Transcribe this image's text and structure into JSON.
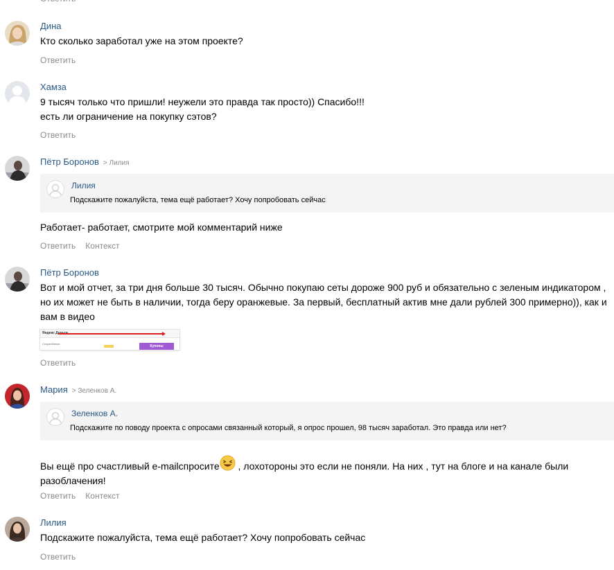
{
  "actions": {
    "reply": "Ответить",
    "context": "Контекст"
  },
  "comments": [
    {
      "author": "Дина",
      "lines": [
        "Кто сколько заработал уже на этом проекте?"
      ]
    },
    {
      "author": "Хамза",
      "lines": [
        "9 тысяч только что пришли! неужели это правда так просто)) Спасибо!!!",
        "есть ли ограничение на покупку сэтов?"
      ]
    },
    {
      "author": "Пётр Боронов",
      "reply_to": "> Лилия",
      "quote": {
        "author": "Лилия",
        "text": "Подскажите пожалуйста, тема ещё работает? Хочу попробовать сейчас"
      },
      "lines": [
        "Работает- работает, смотрите мой комментарий ниже"
      ]
    },
    {
      "author": "Пётр Боронов",
      "text": "Вот и мой отчет, за три дня больше 30 тысяч. Обычно покупаю сеты дороже 900 руб и обязательно с зеленым индикатором , но их может не быть в наличии, тогда беру оранжевые. За первый, бесплатный актив мне дали рублей 300 примерно)), как и вам в видео",
      "image": {
        "logo": "Яндекс Деньги",
        "button": "Купоны",
        "small": "Сохранённые"
      }
    },
    {
      "author": "Мария",
      "reply_to": "> Зеленков А.",
      "quote": {
        "author": "Зеленков А.",
        "text": "Подскажите по поводу проекта с опросами связанный который, я опрос прошел, 98 тысяч заработал. Это правда или нет?"
      },
      "text_before": "Вы ещё про счастливый e-mailспросите",
      "text_after": " , лохотороны это если не поняли. На них , тут на блоге и на канале были разоблачения!",
      "emoji": "laughing-emoji"
    },
    {
      "author": "Лилия",
      "lines": [
        "Подскажите пожалуйста, тема ещё работает? Хочу попробовать сейчас"
      ]
    }
  ]
}
